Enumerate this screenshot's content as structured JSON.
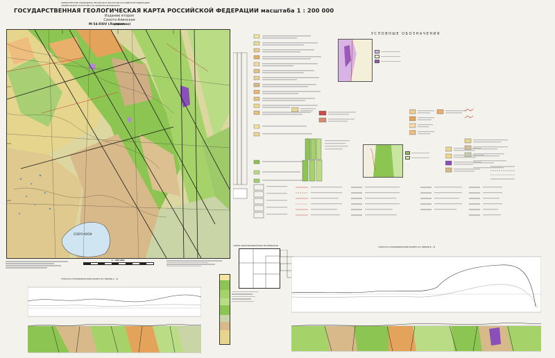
{
  "header": {
    "ministry_lines": [
      "МИНИСТЕРСТВО ПРИРОДНЫХ РЕСУРСОВ И ЭКОЛОГИИ РОССИЙСКОЙ ФЕДЕРАЦИИ",
      "ФЕДЕРАЛЬНОЕ АГЕНТСТВО ПО НЕДРОПОЛЬЗОВАНИЮ"
    ],
    "title": "ГОСУДАРСТВЕННАЯ ГЕОЛОГИЧЕСКАЯ КАРТА РОССИЙСКОЙ ФЕДЕРАЦИИ масштаба 1 : 200 000",
    "edition": "Издание второе",
    "series": "Сихотэ-Алинская серия",
    "sheet": "M-54-XXIV (Ларионово)"
  },
  "map": {
    "lake_label": "ОЗЕРО КИЗИ",
    "scale_label": "1 : 200 000"
  },
  "legend": {
    "title": "УСЛОВНЫЕ ОБОЗНАЧЕНИЯ",
    "stratigraphic_units": [
      "Q",
      "aQ",
      "N",
      "P",
      "K2",
      "K1",
      "J3",
      "J2"
    ]
  },
  "section1": {
    "title": "ГЕОЛОГО-ГЕОФИЗИЧЕСКИЙ РАЗРЕЗ ПО ЛИНИИ А - Б"
  },
  "section2": {
    "title": "ГЕОЛОГО-ГЕОФИЗИЧЕСКИЙ РАЗРЕЗ ПО ЛИНИИ Б - В"
  },
  "index": {
    "title": "СХЕМА ИСПОЛЬЗОВАННЫХ МАТЕРИАЛОВ"
  },
  "colors": {
    "green": "#8cc552",
    "yellow": "#e6d58c",
    "tan": "#d8b98a",
    "orange": "#e4a35a",
    "purple": "#8a4fb8",
    "water": "#cfe6f2"
  }
}
